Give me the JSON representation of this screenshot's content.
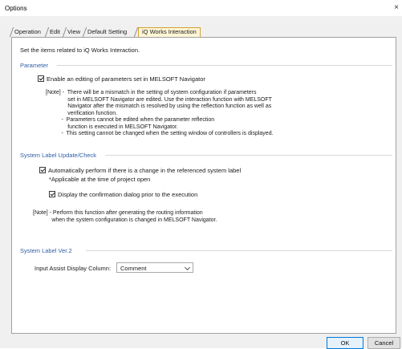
{
  "window": {
    "title": "Options",
    "close_glyph": "×"
  },
  "tabs": [
    {
      "label": "Operation",
      "active": false
    },
    {
      "label": "Edit",
      "active": false
    },
    {
      "label": "View",
      "active": false
    },
    {
      "label": "Default Setting",
      "active": false
    },
    {
      "label": "iQ Works Interaction",
      "active": true
    }
  ],
  "intro": "Set the items related to iQ Works Interaction.",
  "parameter": {
    "header": "Parameter",
    "checkbox_label": "Enable an editing of parameters set in MELSOFT Navigator",
    "checked": true,
    "note": "[Note] -  There will be a mismatch in the setting of system configuration if parameters\n              set in MELSOFT Navigator are edited. Use the interaction function with MELSOFT\n              Navigator after the mismatch is resolved by using the reflection function as well as\n              verification function.\n          -  Parameters cannot be edited when the parameter reflection\n              function is executed in MELSOFT Navigator.\n          -  This setting cannot be changed when the setting window of controllers is displayed."
  },
  "system_label": {
    "header": "System Label Update/Check",
    "auto_label": "Automatically perform if there is a change in the referenced system label",
    "auto_checked": true,
    "applicable": "*Applicable at the time of project open",
    "display_label": "Display the confirmation dialog prior to the execution",
    "display_checked": true,
    "note": "[Note] - Perform this function after generating the routing information\n            when the system configuration is changed in MELSOFT Navigator."
  },
  "system_label_v2": {
    "header": "System Label Ver.2",
    "field_label": "Input Assist Display Column:",
    "selected": "Comment"
  },
  "buttons": {
    "ok": "OK",
    "cancel": "Cancel"
  }
}
